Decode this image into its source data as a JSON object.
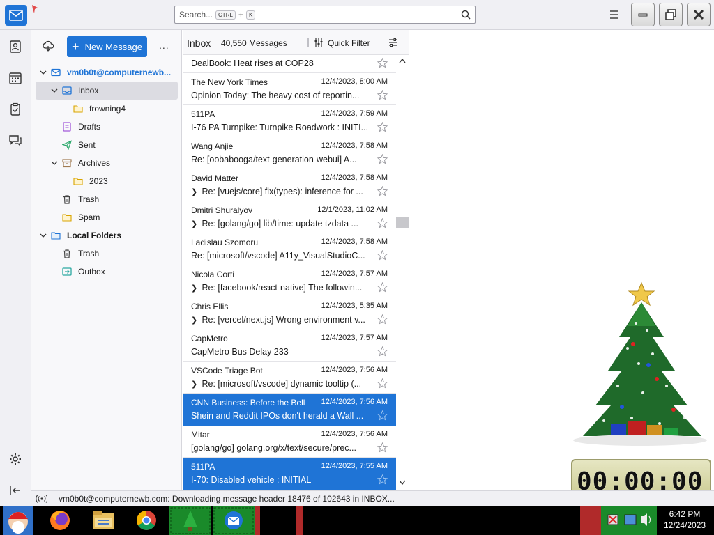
{
  "search": {
    "placeholder": "Search...",
    "key1": "CTRL",
    "plus": "+",
    "key2": "K"
  },
  "folder_pane": {
    "new_message": "New Message",
    "more": "...",
    "account": "vm0b0t@computernewb...",
    "folders": [
      {
        "label": "Inbox"
      },
      {
        "label": "frowning4"
      },
      {
        "label": "Drafts"
      },
      {
        "label": "Sent"
      },
      {
        "label": "Archives"
      },
      {
        "label": "2023"
      },
      {
        "label": "Trash"
      },
      {
        "label": "Spam"
      },
      {
        "label": "Local Folders"
      },
      {
        "label": "Trash"
      },
      {
        "label": "Outbox"
      }
    ]
  },
  "list": {
    "folder_name": "Inbox",
    "count": "40,550 Messages",
    "quick_filter": "Quick Filter",
    "messages": [
      {
        "sender": "",
        "date": "",
        "subject": "DealBook: Heat rises at COP28"
      },
      {
        "sender": "The New York Times",
        "date": "12/4/2023, 8:00 AM",
        "subject": "Opinion Today: The heavy cost of reportin..."
      },
      {
        "sender": "511PA",
        "date": "12/4/2023, 7:59 AM",
        "subject": "I-76 PA Turnpike: Turnpike Roadwork : INITI..."
      },
      {
        "sender": "Wang Anjie",
        "date": "12/4/2023, 7:58 AM",
        "subject": "Re: [oobabooga/text-generation-webui] A..."
      },
      {
        "sender": "David Matter",
        "date": "12/4/2023, 7:58 AM",
        "subject": "Re: [vuejs/core] fix(types): inference for ..."
      },
      {
        "sender": "Dmitri Shuralyov",
        "date": "12/1/2023, 11:02 AM",
        "subject": "Re: [golang/go] lib/time: update tzdata ..."
      },
      {
        "sender": "Ladislau Szomoru",
        "date": "12/4/2023, 7:58 AM",
        "subject": "Re: [microsoft/vscode] A11y_VisualStudioC..."
      },
      {
        "sender": "Nicola Corti",
        "date": "12/4/2023, 7:57 AM",
        "subject": "Re: [facebook/react-native] The followin..."
      },
      {
        "sender": "Chris Ellis",
        "date": "12/4/2023, 5:35 AM",
        "subject": "Re: [vercel/next.js] Wrong environment v..."
      },
      {
        "sender": "CapMetro",
        "date": "12/4/2023, 7:57 AM",
        "subject": "CapMetro Bus Delay 233"
      },
      {
        "sender": "VSCode Triage Bot",
        "date": "12/4/2023, 7:56 AM",
        "subject": "Re: [microsoft/vscode] dynamic tooltip (..."
      },
      {
        "sender": "CNN Business: Before the Bell",
        "date": "12/4/2023, 7:56 AM",
        "subject": "Shein and Reddit IPOs don't herald a Wall ..."
      },
      {
        "sender": "Mitar",
        "date": "12/4/2023, 7:56 AM",
        "subject": "[golang/go] golang.org/x/text/secure/prec..."
      },
      {
        "sender": "511PA",
        "date": "12/4/2023, 7:55 AM",
        "subject": "I-70: Disabled vehicle : INITIAL"
      }
    ]
  },
  "status": {
    "text": "vm0b0t@computernewb.com: Downloading message header 18476 of 102643 in INBOX..."
  },
  "timer": {
    "display": "00:00:00"
  },
  "taskbar": {
    "time": "6:42 PM",
    "date": "12/24/2023"
  },
  "colors": {
    "accent": "#1f74d6",
    "selected_row": "#1f74d6",
    "folder_yellow": "#f5c542"
  }
}
